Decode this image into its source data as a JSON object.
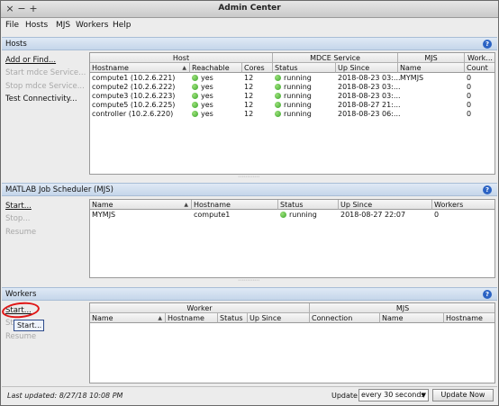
{
  "window": {
    "title": "Admin Center",
    "minimize": "−",
    "maximize": "+",
    "close": "×"
  },
  "menu": [
    "File",
    "Hosts",
    "MJS",
    "Workers",
    "Help"
  ],
  "hosts": {
    "title": "Hosts",
    "help": "?",
    "actions": [
      {
        "label": "Add or Find...",
        "enabled": true
      },
      {
        "label": "Start mdce Service...",
        "enabled": false
      },
      {
        "label": "Stop mdce Service...",
        "enabled": false
      },
      {
        "label": "Test Connectivity...",
        "enabled": true
      }
    ],
    "groups": [
      "Host",
      "MDCE Service",
      "MJS",
      "Work..."
    ],
    "columns": [
      "Hostname",
      "Reachable",
      "Cores",
      "Status",
      "Up Since",
      "Name",
      "Count"
    ],
    "rows": [
      {
        "hostname": "compute1 (10.2.6.221)",
        "reachable": "yes",
        "cores": "12",
        "status": "running",
        "up_since": "2018-08-23 03:...",
        "mjs": "MYMJS",
        "count": "0"
      },
      {
        "hostname": "compute2 (10.2.6.222)",
        "reachable": "yes",
        "cores": "12",
        "status": "running",
        "up_since": "2018-08-23 03:...",
        "mjs": "",
        "count": "0"
      },
      {
        "hostname": "compute3 (10.2.6.223)",
        "reachable": "yes",
        "cores": "12",
        "status": "running",
        "up_since": "2018-08-23 03:...",
        "mjs": "",
        "count": "0"
      },
      {
        "hostname": "compute5 (10.2.6.225)",
        "reachable": "yes",
        "cores": "12",
        "status": "running",
        "up_since": "2018-08-27 21:...",
        "mjs": "",
        "count": "0"
      },
      {
        "hostname": "controller (10.2.6.220)",
        "reachable": "yes",
        "cores": "12",
        "status": "running",
        "up_since": "2018-08-23 06:...",
        "mjs": "",
        "count": "0"
      }
    ]
  },
  "mjs": {
    "title": "MATLAB Job Scheduler (MJS)",
    "help": "?",
    "actions": [
      {
        "label": "Start...",
        "enabled": true
      },
      {
        "label": "Stop...",
        "enabled": false
      },
      {
        "label": "Resume",
        "enabled": false
      }
    ],
    "columns": [
      "Name",
      "Hostname",
      "Status",
      "Up Since",
      "Workers"
    ],
    "rows": [
      {
        "name": "MYMJS",
        "hostname": "compute1",
        "status": "running",
        "up_since": "2018-08-27 22:07",
        "workers": "0"
      }
    ]
  },
  "workers": {
    "title": "Workers",
    "help": "?",
    "actions": [
      {
        "label": "Start...",
        "enabled": true
      },
      {
        "label": "Stop",
        "enabled": false
      },
      {
        "label": "Resume",
        "enabled": false
      }
    ],
    "tooltip": "Start...",
    "groups": [
      "Worker",
      "MJS"
    ],
    "columns": [
      "Name",
      "Hostname",
      "Status",
      "Up Since",
      "Connection",
      "Name",
      "Hostname"
    ]
  },
  "status": {
    "last_updated": "Last updated: 8/27/18 10:08 PM",
    "update_label": "Update",
    "interval": "every 30 seconds",
    "update_button": "Update Now"
  },
  "splitter": "⋯⋯⋯⋯"
}
